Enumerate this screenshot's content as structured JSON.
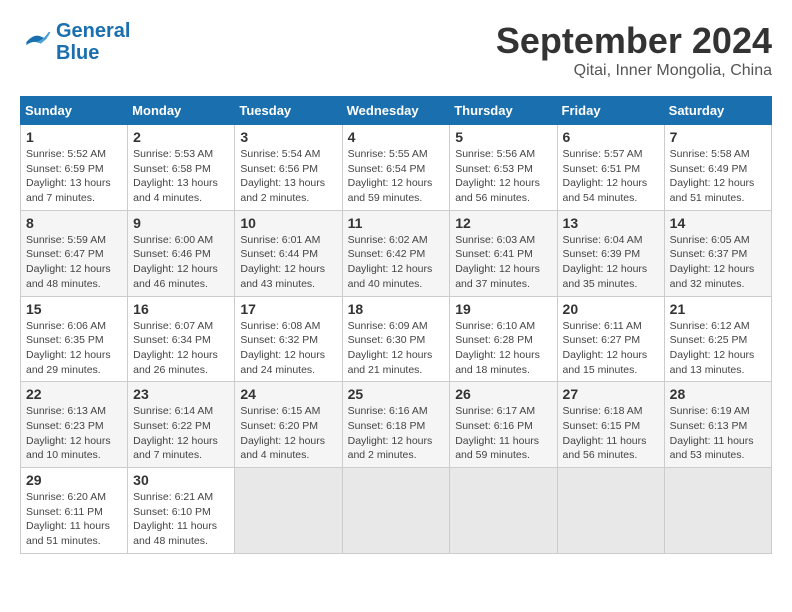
{
  "header": {
    "logo": {
      "line1": "General",
      "line2": "Blue"
    },
    "month": "September 2024",
    "location": "Qitai, Inner Mongolia, China"
  },
  "days_of_week": [
    "Sunday",
    "Monday",
    "Tuesday",
    "Wednesday",
    "Thursday",
    "Friday",
    "Saturday"
  ],
  "weeks": [
    [
      {
        "day": "1",
        "sunrise": "5:52 AM",
        "sunset": "6:59 PM",
        "daylight": "13 hours and 7 minutes."
      },
      {
        "day": "2",
        "sunrise": "5:53 AM",
        "sunset": "6:58 PM",
        "daylight": "13 hours and 4 minutes."
      },
      {
        "day": "3",
        "sunrise": "5:54 AM",
        "sunset": "6:56 PM",
        "daylight": "13 hours and 2 minutes."
      },
      {
        "day": "4",
        "sunrise": "5:55 AM",
        "sunset": "6:54 PM",
        "daylight": "12 hours and 59 minutes."
      },
      {
        "day": "5",
        "sunrise": "5:56 AM",
        "sunset": "6:53 PM",
        "daylight": "12 hours and 56 minutes."
      },
      {
        "day": "6",
        "sunrise": "5:57 AM",
        "sunset": "6:51 PM",
        "daylight": "12 hours and 54 minutes."
      },
      {
        "day": "7",
        "sunrise": "5:58 AM",
        "sunset": "6:49 PM",
        "daylight": "12 hours and 51 minutes."
      }
    ],
    [
      {
        "day": "8",
        "sunrise": "5:59 AM",
        "sunset": "6:47 PM",
        "daylight": "12 hours and 48 minutes."
      },
      {
        "day": "9",
        "sunrise": "6:00 AM",
        "sunset": "6:46 PM",
        "daylight": "12 hours and 46 minutes."
      },
      {
        "day": "10",
        "sunrise": "6:01 AM",
        "sunset": "6:44 PM",
        "daylight": "12 hours and 43 minutes."
      },
      {
        "day": "11",
        "sunrise": "6:02 AM",
        "sunset": "6:42 PM",
        "daylight": "12 hours and 40 minutes."
      },
      {
        "day": "12",
        "sunrise": "6:03 AM",
        "sunset": "6:41 PM",
        "daylight": "12 hours and 37 minutes."
      },
      {
        "day": "13",
        "sunrise": "6:04 AM",
        "sunset": "6:39 PM",
        "daylight": "12 hours and 35 minutes."
      },
      {
        "day": "14",
        "sunrise": "6:05 AM",
        "sunset": "6:37 PM",
        "daylight": "12 hours and 32 minutes."
      }
    ],
    [
      {
        "day": "15",
        "sunrise": "6:06 AM",
        "sunset": "6:35 PM",
        "daylight": "12 hours and 29 minutes."
      },
      {
        "day": "16",
        "sunrise": "6:07 AM",
        "sunset": "6:34 PM",
        "daylight": "12 hours and 26 minutes."
      },
      {
        "day": "17",
        "sunrise": "6:08 AM",
        "sunset": "6:32 PM",
        "daylight": "12 hours and 24 minutes."
      },
      {
        "day": "18",
        "sunrise": "6:09 AM",
        "sunset": "6:30 PM",
        "daylight": "12 hours and 21 minutes."
      },
      {
        "day": "19",
        "sunrise": "6:10 AM",
        "sunset": "6:28 PM",
        "daylight": "12 hours and 18 minutes."
      },
      {
        "day": "20",
        "sunrise": "6:11 AM",
        "sunset": "6:27 PM",
        "daylight": "12 hours and 15 minutes."
      },
      {
        "day": "21",
        "sunrise": "6:12 AM",
        "sunset": "6:25 PM",
        "daylight": "12 hours and 13 minutes."
      }
    ],
    [
      {
        "day": "22",
        "sunrise": "6:13 AM",
        "sunset": "6:23 PM",
        "daylight": "12 hours and 10 minutes."
      },
      {
        "day": "23",
        "sunrise": "6:14 AM",
        "sunset": "6:22 PM",
        "daylight": "12 hours and 7 minutes."
      },
      {
        "day": "24",
        "sunrise": "6:15 AM",
        "sunset": "6:20 PM",
        "daylight": "12 hours and 4 minutes."
      },
      {
        "day": "25",
        "sunrise": "6:16 AM",
        "sunset": "6:18 PM",
        "daylight": "12 hours and 2 minutes."
      },
      {
        "day": "26",
        "sunrise": "6:17 AM",
        "sunset": "6:16 PM",
        "daylight": "11 hours and 59 minutes."
      },
      {
        "day": "27",
        "sunrise": "6:18 AM",
        "sunset": "6:15 PM",
        "daylight": "11 hours and 56 minutes."
      },
      {
        "day": "28",
        "sunrise": "6:19 AM",
        "sunset": "6:13 PM",
        "daylight": "11 hours and 53 minutes."
      }
    ],
    [
      {
        "day": "29",
        "sunrise": "6:20 AM",
        "sunset": "6:11 PM",
        "daylight": "11 hours and 51 minutes."
      },
      {
        "day": "30",
        "sunrise": "6:21 AM",
        "sunset": "6:10 PM",
        "daylight": "11 hours and 48 minutes."
      },
      null,
      null,
      null,
      null,
      null
    ]
  ],
  "labels": {
    "sunrise": "Sunrise:",
    "sunset": "Sunset:",
    "daylight": "Daylight:"
  }
}
